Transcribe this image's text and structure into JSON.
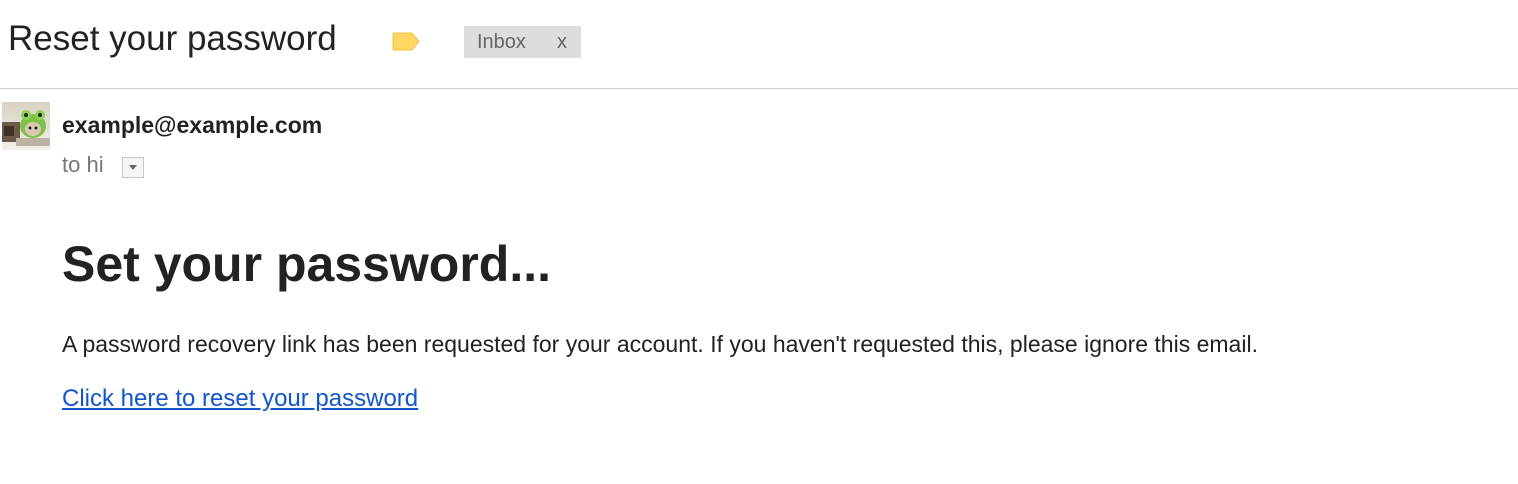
{
  "header": {
    "subject": "Reset your password",
    "label_icon": "label-tag-icon",
    "label_color": "#fdd663",
    "inbox_chip": {
      "label": "Inbox",
      "remove": "x"
    }
  },
  "message": {
    "avatar_icon": "frog-avatar",
    "sender": "example@example.com",
    "recipient_line": "to hi",
    "details_icon": "chevron-down-icon"
  },
  "body": {
    "heading": "Set your password...",
    "paragraph": "A password recovery link has been requested for your account. If you haven't requested this, please ignore this email.",
    "link_text": "Click here to reset your password",
    "link_color": "#1155cc"
  }
}
